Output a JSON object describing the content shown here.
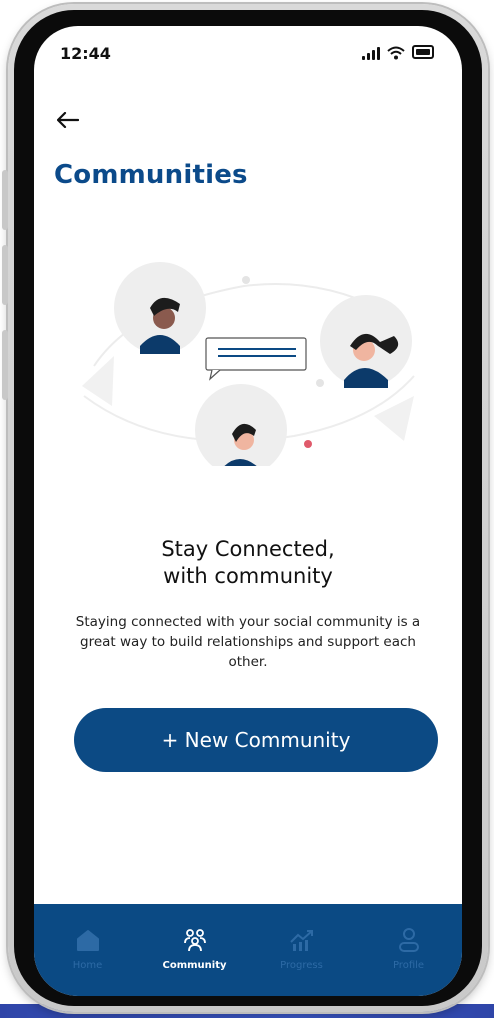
{
  "status_bar": {
    "time": "12:44"
  },
  "header": {
    "title": "Communities"
  },
  "content": {
    "headline_line1": "Stay Connected,",
    "headline_line2": "with community",
    "description": "Staying connected with your social community is a great way to build relationships and support each other.",
    "new_community_label": "+ New Community"
  },
  "bottom_nav": {
    "items": [
      {
        "label": "Home",
        "icon": "home-icon",
        "active": false
      },
      {
        "label": "Community",
        "icon": "community-icon",
        "active": true
      },
      {
        "label": "Progress",
        "icon": "progress-icon",
        "active": false
      },
      {
        "label": "Profile",
        "icon": "profile-icon",
        "active": false
      }
    ]
  },
  "colors": {
    "primary": "#0c4a84",
    "title": "#0b4a8a",
    "accent_dot": "#e05a6b",
    "nav_inactive": "#2d6aa5"
  }
}
